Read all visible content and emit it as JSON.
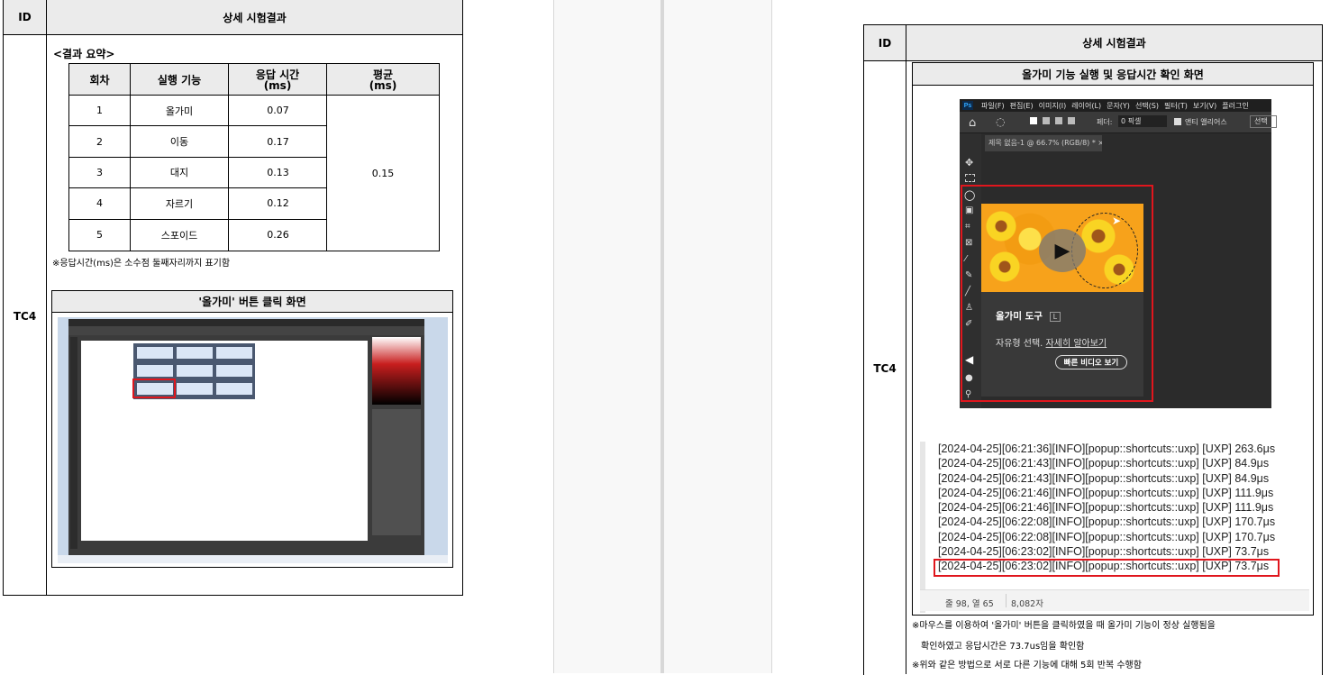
{
  "left": {
    "header_id": "ID",
    "header_result": "상세 시험결과",
    "row_id": "TC4",
    "summary_title": "<결과 요약>",
    "summary_headers": [
      "회차",
      "실행 기능",
      "응답 시간\n(ms)",
      "평균\n(ms)"
    ],
    "summary_rows": [
      {
        "round": "1",
        "func": "올가미",
        "time": "0.07"
      },
      {
        "round": "2",
        "func": "이동",
        "time": "0.17"
      },
      {
        "round": "3",
        "func": "대지",
        "time": "0.13"
      },
      {
        "round": "4",
        "func": "자르기",
        "time": "0.12"
      },
      {
        "round": "5",
        "func": "스포이드",
        "time": "0.26"
      }
    ],
    "average": "0.15",
    "note": "※응답시간(ms)은 소수점 둘째자리까지 표기함",
    "screenshot_title": "'올가미' 버튼 클릭 화면"
  },
  "right": {
    "header_id": "ID",
    "header_result": "상세 시험결과",
    "row_id": "TC4",
    "inner_title": "올가미 기능 실행 및 응답시간 확인 화면",
    "ps_menu": [
      "파일(F)",
      "편집(E)",
      "이미지(I)",
      "레이어(L)",
      "문자(Y)",
      "선택(S)",
      "필터(T)",
      "보기(V)",
      "플러그인"
    ],
    "ps_options": {
      "feather": "페더:",
      "feather_value": "0 픽셀",
      "antialias": "앤티 앨리어스",
      "select": "선택"
    },
    "ps_tab": "제목 없음-1 @ 66.7% (RGB/8) *",
    "tooltip_title": "올가미 도구",
    "tooltip_key": "L",
    "tooltip_desc": "자유형 선택.",
    "tooltip_link": "자세히 알아보기",
    "tooltip_button": "빠른 비디오 보기",
    "log_lines": [
      "[2024-04-25][06:21:36][INFO][popup::shortcuts::uxp] [UXP] 263.6μs",
      "[2024-04-25][06:21:43][INFO][popup::shortcuts::uxp] [UXP] 84.9μs",
      "[2024-04-25][06:21:43][INFO][popup::shortcuts::uxp] [UXP] 84.9μs",
      "[2024-04-25][06:21:46][INFO][popup::shortcuts::uxp] [UXP] 111.9μs",
      "[2024-04-25][06:21:46][INFO][popup::shortcuts::uxp] [UXP] 111.9μs",
      "[2024-04-25][06:22:08][INFO][popup::shortcuts::uxp] [UXP] 170.7μs",
      "[2024-04-25][06:22:08][INFO][popup::shortcuts::uxp] [UXP] 170.7μs",
      "[2024-04-25][06:23:02][INFO][popup::shortcuts::uxp] [UXP] 73.7μs",
      "[2024-04-25][06:23:02][INFO][popup::shortcuts::uxp] [UXP] 73.7μs"
    ],
    "log_status_pos": "줄 98, 열 65",
    "log_status_chars": "8,082자",
    "note1": "※마우스를 이용하여 '올가미' 버튼을 클릭하였을 때 올가미 기능이 정상 실행됨을",
    "note2": "확인하였고 응답시간은 73.7us임을 확인함",
    "note3": "※위와 같은 방법으로 서로 다른 기능에 대해 5회 반복 수행함"
  },
  "colors": {
    "highlight_red": "#e0161d",
    "header_gray": "#ebebeb",
    "ps_dark": "#323232",
    "flower_orange": "#f7a21b"
  }
}
